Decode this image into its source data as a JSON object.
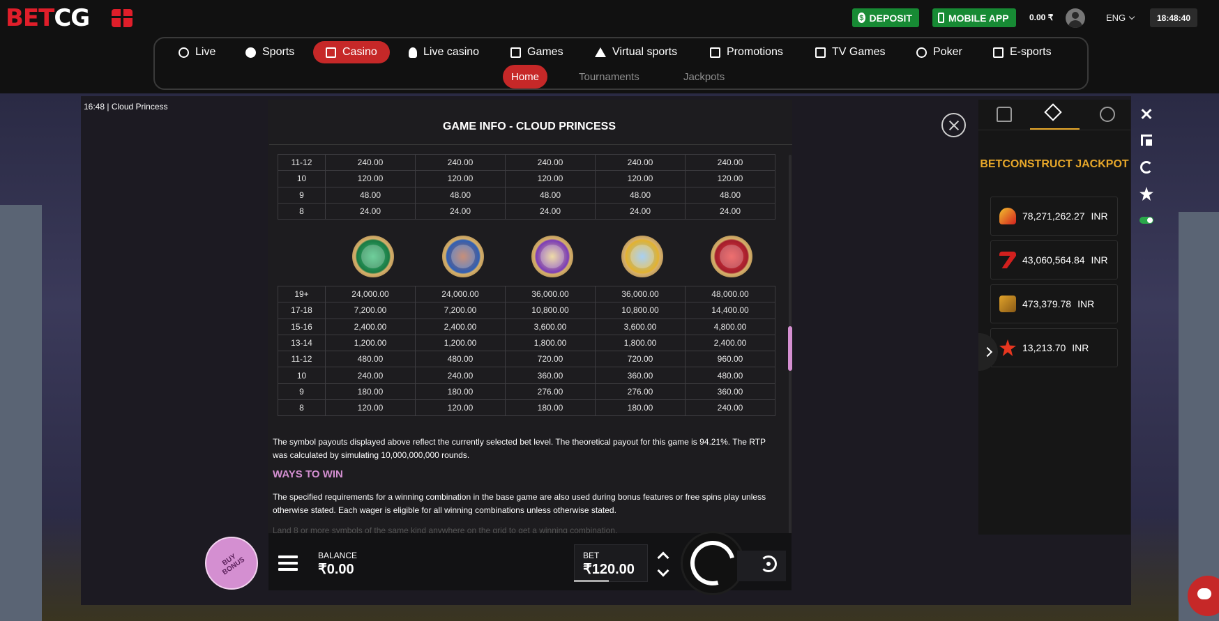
{
  "brand": {
    "logo_part1": "BET",
    "logo_part2": "CG"
  },
  "header": {
    "deposit_label": "DEPOSIT",
    "mobile_app_label": "MOBILE APP",
    "balance": "0.00 ₹",
    "language": "ENG",
    "clock": "18:48:40"
  },
  "nav": {
    "items": [
      {
        "label": "Live",
        "icon": "live-icon"
      },
      {
        "label": "Sports",
        "icon": "ball-icon"
      },
      {
        "label": "Casino",
        "icon": "slot-icon",
        "active": true
      },
      {
        "label": "Live casino",
        "icon": "dealer-icon"
      },
      {
        "label": "Games",
        "icon": "dice-icon"
      },
      {
        "label": "Virtual sports",
        "icon": "virtual-icon"
      },
      {
        "label": "Promotions",
        "icon": "gift-icon"
      },
      {
        "label": "TV Games",
        "icon": "tv-icon"
      },
      {
        "label": "Poker",
        "icon": "chip-icon"
      },
      {
        "label": "E-sports",
        "icon": "esports-icon"
      }
    ],
    "sub_items": [
      {
        "label": "Home",
        "active": true
      },
      {
        "label": "Tournaments"
      },
      {
        "label": "Jackpots"
      }
    ]
  },
  "game": {
    "time": "16:48",
    "name": "Cloud Princess"
  },
  "info": {
    "title": "GAME INFO - CLOUD PRINCESS",
    "top_table": [
      [
        "11-12",
        "240.00",
        "240.00",
        "240.00",
        "240.00",
        "240.00"
      ],
      [
        "10",
        "120.00",
        "120.00",
        "120.00",
        "120.00",
        "120.00"
      ],
      [
        "9",
        "48.00",
        "48.00",
        "48.00",
        "48.00",
        "48.00"
      ],
      [
        "8",
        "24.00",
        "24.00",
        "24.00",
        "24.00",
        "24.00"
      ]
    ],
    "symbols": [
      "green-harp-symbol-icon",
      "blue-teacup-symbol-icon",
      "purple-shell-symbol-icon",
      "gold-box-symbol-icon",
      "red-octopus-symbol-icon"
    ],
    "bottom_table": [
      [
        "19+",
        "24,000.00",
        "24,000.00",
        "36,000.00",
        "36,000.00",
        "48,000.00"
      ],
      [
        "17-18",
        "7,200.00",
        "7,200.00",
        "10,800.00",
        "10,800.00",
        "14,400.00"
      ],
      [
        "15-16",
        "2,400.00",
        "2,400.00",
        "3,600.00",
        "3,600.00",
        "4,800.00"
      ],
      [
        "13-14",
        "1,200.00",
        "1,200.00",
        "1,800.00",
        "1,800.00",
        "2,400.00"
      ],
      [
        "11-12",
        "480.00",
        "480.00",
        "720.00",
        "720.00",
        "960.00"
      ],
      [
        "10",
        "240.00",
        "240.00",
        "360.00",
        "360.00",
        "480.00"
      ],
      [
        "9",
        "180.00",
        "180.00",
        "276.00",
        "276.00",
        "360.00"
      ],
      [
        "8",
        "120.00",
        "120.00",
        "180.00",
        "180.00",
        "240.00"
      ]
    ],
    "rtp_text": "The symbol payouts displayed above reflect the currently selected bet level. The theoretical payout for this game is 94.21%. The RTP was calculated by simulating 10,000,000,000 rounds.",
    "ways_heading": "WAYS TO WIN",
    "ways_text": "The specified requirements for a winning combination in the base game are also used during bonus features or free spins play unless otherwise stated. Each wager is eligible for all winning combinations unless otherwise stated.",
    "faded_text": "Land 8 or more symbols of the same kind anywhere on the grid to get a winning combination."
  },
  "controls": {
    "buy_bonus": "BUY BONUS",
    "balance_label": "BALANCE",
    "balance_value": "₹0.00",
    "bet_label": "BET",
    "bet_value": "₹120.00"
  },
  "jackpot": {
    "title": "BETCONSTRUCT JACKPOT",
    "rows": [
      {
        "amount": "78,271,262.27",
        "currency": "INR",
        "icon": "jester-hat-icon"
      },
      {
        "amount": "43,060,564.84",
        "currency": "INR",
        "icon": "lucky-seven-icon"
      },
      {
        "amount": "473,379.78",
        "currency": "INR",
        "icon": "treasure-book-icon"
      },
      {
        "amount": "13,213.70",
        "currency": "INR",
        "icon": "red-star-icon"
      }
    ]
  },
  "colors": {
    "brand_red": "#e01e2a",
    "active_red": "#c62828",
    "deposit_green": "#178a34",
    "accent_pink": "#d48fd1",
    "jackpot_gold": "#e8a82a"
  }
}
